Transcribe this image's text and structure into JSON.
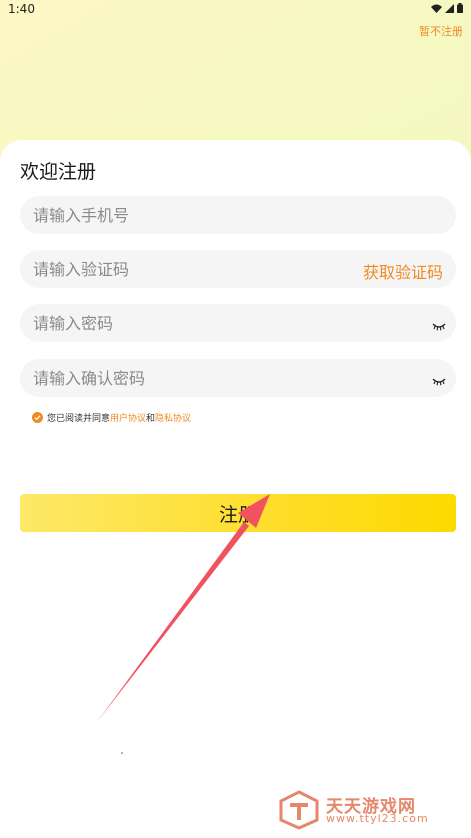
{
  "status_bar": {
    "time": "1:40",
    "icons": [
      "wifi-icon",
      "signal-icon",
      "battery-icon"
    ]
  },
  "header": {
    "skip_label": "暂不注册"
  },
  "form": {
    "title": "欢迎注册",
    "phone_placeholder": "请输入手机号",
    "code_placeholder": "请输入验证码",
    "get_code_label": "获取验证码",
    "password_placeholder": "请输入密码",
    "confirm_placeholder": "请输入确认密码"
  },
  "agreement": {
    "checked": true,
    "prefix": "您已阅读并同意",
    "user_agreement": "用户协议",
    "and": "和",
    "privacy_agreement": "隐私协议"
  },
  "register_button": {
    "label": "注册"
  },
  "watermark": {
    "name": "天天游戏网",
    "url": "www.ttyl23.com"
  },
  "colors": {
    "accent": "#f08a24",
    "button": "#fede2e",
    "annotation_arrow": "#f0525e"
  }
}
